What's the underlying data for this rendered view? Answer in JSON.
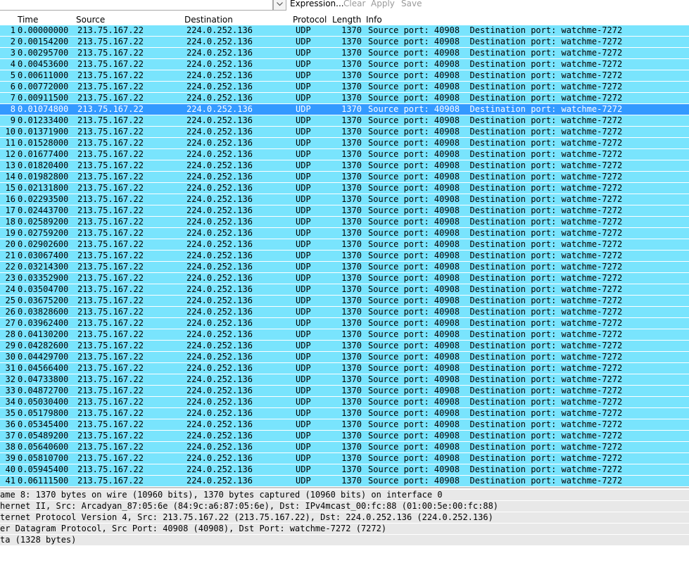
{
  "filter": {
    "value": "",
    "expression_label": "Expression...",
    "clear_label": "Clear",
    "apply_label": "Apply",
    "save_label": "Save"
  },
  "columns": {
    "no": "",
    "time": "Time",
    "source": "Source",
    "destination": "Destination",
    "protocol": "Protocol",
    "length": "Length",
    "info": "Info"
  },
  "shared": {
    "source": "213.75.167.22",
    "destination": "224.0.252.136",
    "protocol": "UDP",
    "length": "1370",
    "info": "Source port: 40908  Destination port: watchme-7272"
  },
  "selected_row": 8,
  "times": [
    "0.00000000",
    "0.00154200",
    "0.00295700",
    "0.00453600",
    "0.00611000",
    "0.00772000",
    "0.00911500",
    "0.01074800",
    "0.01233400",
    "0.01371900",
    "0.01528000",
    "0.01677400",
    "0.01820400",
    "0.01982800",
    "0.02131800",
    "0.02293500",
    "0.02443700",
    "0.02589200",
    "0.02759200",
    "0.02902600",
    "0.03067400",
    "0.03214300",
    "0.03352900",
    "0.03504700",
    "0.03675200",
    "0.03828600",
    "0.03962400",
    "0.04130200",
    "0.04282600",
    "0.04429700",
    "0.04566400",
    "0.04733800",
    "0.04872700",
    "0.05030400",
    "0.05179800",
    "0.05345400",
    "0.05489200",
    "0.05640600",
    "0.05810700",
    "0.05945400",
    "0.06111500"
  ],
  "colors": {
    "row_bg": "#79e4fd",
    "selected_bg": "#3399ff",
    "detail_bg": "#e8e8e8"
  },
  "details": [
    "ame 8: 1370 bytes on wire (10960 bits), 1370 bytes captured (10960 bits) on interface 0",
    "hernet II, Src: Arcadyan_87:05:6e (84:9c:a6:87:05:6e), Dst: IPv4mcast_00:fc:88 (01:00:5e:00:fc:88)",
    "ternet Protocol Version 4, Src: 213.75.167.22 (213.75.167.22), Dst: 224.0.252.136 (224.0.252.136)",
    "er Datagram Protocol, Src Port: 40908 (40908), Dst Port: watchme-7272 (7272)",
    "ta (1328 bytes)"
  ]
}
